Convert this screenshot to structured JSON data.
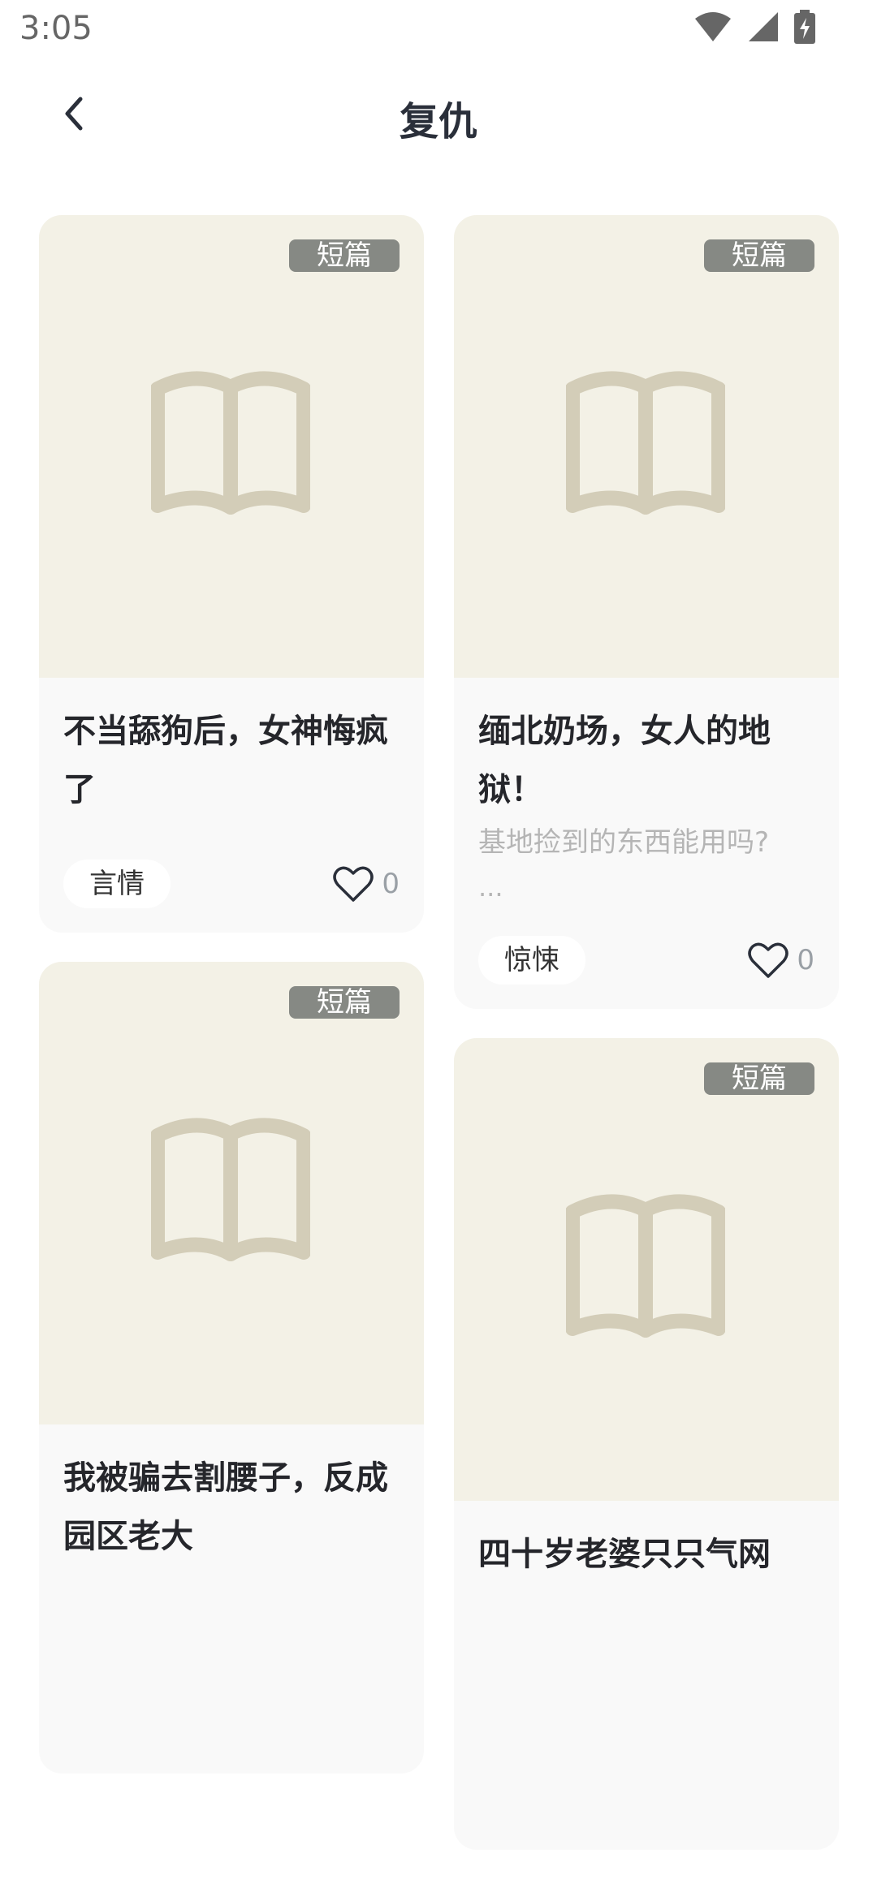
{
  "status_bar": {
    "time": "3:05"
  },
  "header": {
    "title": "复仇"
  },
  "cards_left": [
    {
      "badge": "短篇",
      "title": "不当舔狗后，女神悔疯了",
      "genre": "言情",
      "likes": "0"
    },
    {
      "badge": "短篇",
      "title": "我被骗去割腰子，反成园区老大"
    }
  ],
  "cards_right": [
    {
      "badge": "短篇",
      "title": "缅北奶场，女人的地狱！",
      "description": "基地捡到的东西能用吗?",
      "ellipsis": "...",
      "genre": "惊悚",
      "likes": "0"
    },
    {
      "badge": "短篇",
      "title": "四十岁老婆只只气网"
    }
  ],
  "colors": {
    "cover_bg": "#f3f1e6",
    "badge_bg": "#868984",
    "card_bg": "#f9f9f9",
    "book_icon": "#d3cdb8"
  }
}
